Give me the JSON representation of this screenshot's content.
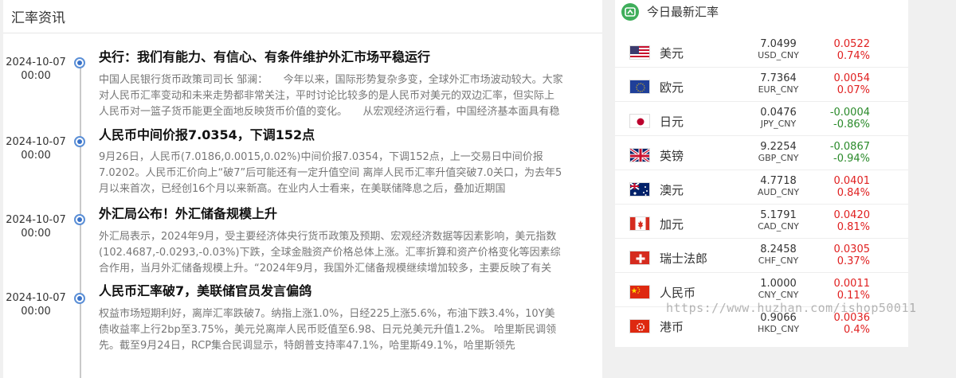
{
  "news": {
    "header": "汇率资讯",
    "items": [
      {
        "date": "2024-10-07",
        "time": "00:00",
        "title": "央行：我们有能力、有信心、有条件维护外汇市场平稳运行",
        "body": "中国人民银行货币政策司司长 邹澜：　　今年以来，国际形势复杂多变，全球外汇市场波动较大。大家对人民币汇率变动和未来走势都非常关注，平时讨论比较多的是人民币对美元的双边汇率，但实际上人民币对一篮子货币能更全面地反映货币价值的变化。　　从宏观经济运行看，中国经济基本面具有稳健性"
      },
      {
        "date": "2024-10-07",
        "time": "00:00",
        "title": "人民币中间价报7.0354，下调152点",
        "body": "9月26日，人民币(7.0186,0.0015,0.02%)中间价报7.0354，下调152点，上一交易日中间价报7.0202。人民币汇价向上“破7”后可能还有一定升值空间 离岸人民币汇率升值突破7.0关口，为去年5月以来首次，已经创16个月以来新高。在业内人士看来，在美联储降息之后，叠加近期国"
      },
      {
        "date": "2024-10-07",
        "time": "00:00",
        "title": "外汇局公布！外汇储备规模上升",
        "body": "外汇局表示，2024年9月，受主要经济体央行货币政策及预期、宏观经济数据等因素影响，美元指数(102.4687,-0.0293,-0.03%)下跌，全球金融资产价格总体上涨。汇率折算和资产价格变化等因素综合作用，当月外汇储备规模上升。“2024年9月，我国外汇储备规模继续增加较多，主要反映了有关"
      },
      {
        "date": "2024-10-07",
        "time": "00:00",
        "title": "人民币汇率破7，美联储官员发言偏鸽",
        "body": "权益市场短期利好，离岸汇率跌破7。纳指上涨1.0%，日经225上涨5.6%，布油下跌3.4%，10Y美债收益率上行2bp至3.75%，美元兑离岸人民币贬值至6.98、日元兑美元升值1.2%。 哈里斯民调领先。截至9月24日，RCP集合民调显示，特朗普支持率47.1%，哈里斯49.1%，哈里斯领先"
      }
    ]
  },
  "rates": {
    "title": "今日最新汇率",
    "title_icon": "exchange-rate-icon",
    "accent_color": "#3fae5b",
    "up_color": "#e02020",
    "down_color": "#2a8a2a",
    "rows": [
      {
        "name": "美元",
        "flag": "us-flag",
        "price": "7.0499",
        "code": "USD_CNY",
        "change": "0.0522",
        "pct": "0.74%",
        "dir": "up"
      },
      {
        "name": "欧元",
        "flag": "eu-flag",
        "price": "7.7364",
        "code": "EUR_CNY",
        "change": "0.0054",
        "pct": "0.07%",
        "dir": "up"
      },
      {
        "name": "日元",
        "flag": "jp-flag",
        "price": "0.0476",
        "code": "JPY_CNY",
        "change": "-0.0004",
        "pct": "-0.86%",
        "dir": "down"
      },
      {
        "name": "英镑",
        "flag": "gb-flag",
        "price": "9.2254",
        "code": "GBP_CNY",
        "change": "-0.0867",
        "pct": "-0.94%",
        "dir": "down"
      },
      {
        "name": "澳元",
        "flag": "au-flag",
        "price": "4.7718",
        "code": "AUD_CNY",
        "change": "0.0401",
        "pct": "0.84%",
        "dir": "up"
      },
      {
        "name": "加元",
        "flag": "ca-flag",
        "price": "5.1791",
        "code": "CAD_CNY",
        "change": "0.0420",
        "pct": "0.81%",
        "dir": "up"
      },
      {
        "name": "瑞士法郎",
        "flag": "ch-flag",
        "price": "8.2458",
        "code": "CHF_CNY",
        "change": "0.0305",
        "pct": "0.37%",
        "dir": "up"
      },
      {
        "name": "人民币",
        "flag": "cn-flag",
        "price": "1.0000",
        "code": "CNY_CNY",
        "change": "0.0011",
        "pct": "0.11%",
        "dir": "up"
      },
      {
        "name": "港币",
        "flag": "hk-flag",
        "price": "0.9066",
        "code": "HKD_CNY",
        "change": "0.0036",
        "pct": "0.4%",
        "dir": "up"
      }
    ]
  },
  "watermark": "https://www.huzhan.com/ishop50011"
}
